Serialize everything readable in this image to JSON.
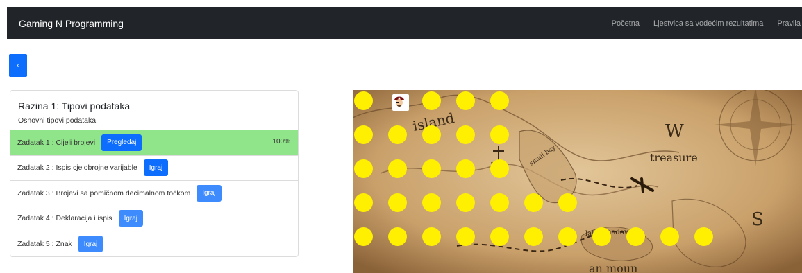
{
  "navbar": {
    "brand": "Gaming N Programming",
    "links": [
      "Početna",
      "Ljestvica sa vodećim rezultatima",
      "Pravila"
    ]
  },
  "back_button": {
    "icon": "chevron-left-icon",
    "label": "‹"
  },
  "level": {
    "title": "Razina 1: Tipovi podataka",
    "subtitle": "Osnovni tipovi podataka",
    "tasks": [
      {
        "label": "Zadatak 1 : Cijeli brojevi",
        "button": "Pregledaj",
        "progress": "100%",
        "completed": true
      },
      {
        "label": "Zadatak 2 : Ispis cjelobrojne varijable",
        "button": "Igraj",
        "completed": false
      },
      {
        "label": "Zadatak 3 : Brojevi sa pomičnom decimalnom točkom",
        "button": "Igraj",
        "completed": false
      },
      {
        "label": "Zadatak 4 : Deklaracija i ispis",
        "button": "Igraj",
        "completed": false
      },
      {
        "label": "Zadatak 5 : Znak",
        "button": "Igraj",
        "completed": false
      }
    ]
  },
  "map": {
    "labels": [
      "island",
      "small bay",
      "W",
      "treasure",
      "lake",
      "hadow",
      "S",
      "an moun"
    ],
    "player_icon": "pirate-icon",
    "colors": {
      "dot": "#ffef00",
      "parchment": "#d9b98a",
      "completed_row": "#90e48a",
      "primary": "#0d6efd"
    }
  }
}
